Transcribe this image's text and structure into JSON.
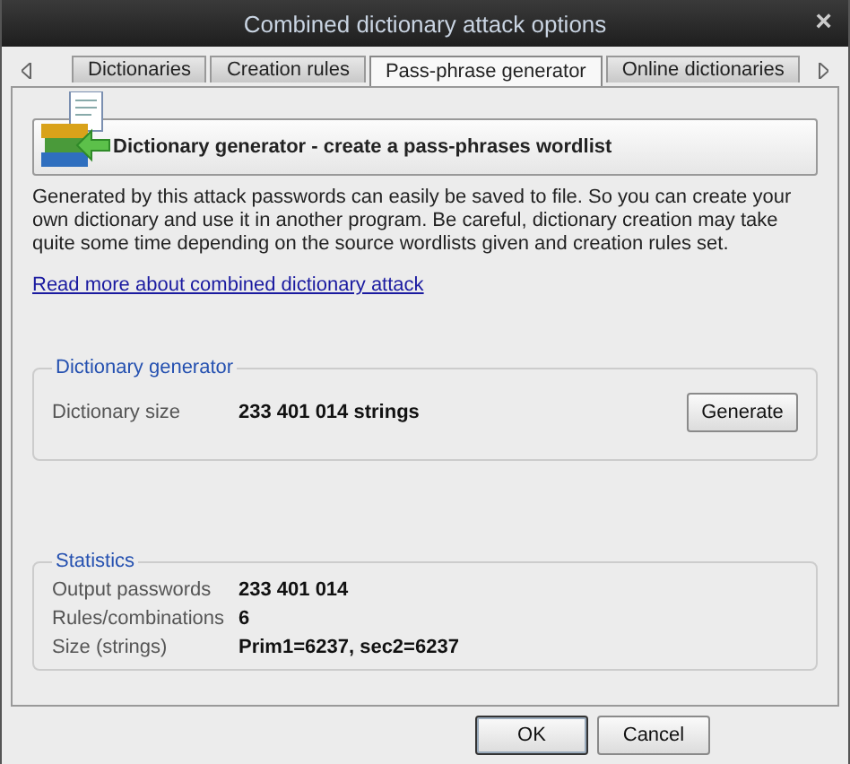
{
  "window": {
    "title": "Combined dictionary attack options",
    "close": "×"
  },
  "tabs": [
    {
      "label": "Dictionaries",
      "selected": false
    },
    {
      "label": "Creation rules",
      "selected": false
    },
    {
      "label": "Pass-phrase generator",
      "selected": true
    },
    {
      "label": "Online dictionaries",
      "selected": false
    }
  ],
  "header": {
    "title": "Dictionary generator - create a pass-phrases wordlist"
  },
  "description": "Generated by this attack passwords can easily be saved to file. So you can create your own dictionary and use it in another program. Be careful, dictionary creation may take quite some time depending on the source wordlists given and creation rules set.",
  "link": "Read more about combined dictionary attack",
  "generator": {
    "title": "Dictionary generator",
    "label": "Dictionary size",
    "value": "233 401 014  strings",
    "button": "Generate"
  },
  "statistics": {
    "title": "Statistics",
    "rows": [
      {
        "label": "Output passwords",
        "value": "233 401 014"
      },
      {
        "label": "Rules/combinations",
        "value": "6"
      },
      {
        "label": "Size (strings)",
        "value": "Prim1=6237, sec2=6237"
      }
    ]
  },
  "buttons": [
    {
      "label": "OK",
      "default": true
    },
    {
      "label": "Cancel",
      "default": false
    }
  ]
}
